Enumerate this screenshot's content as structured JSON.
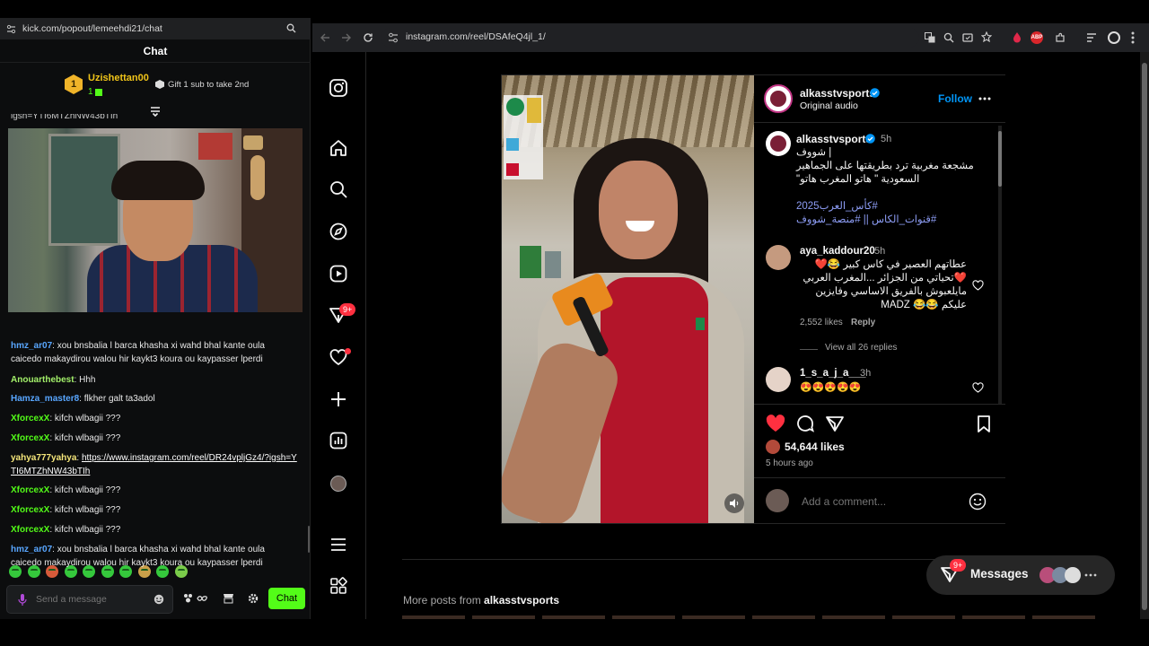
{
  "kick": {
    "url": "kick.com/popout/lemeehdi21/chat",
    "chat_title": "Chat",
    "gifter": {
      "rank": "1",
      "name": "Uzishettan00",
      "count": "1",
      "cta": "Gift 1 sub to take 2nd"
    },
    "top_partial": "igsh=YTI6MTZhNW43bTIh",
    "messages": [
      {
        "user": "hmz_ar07",
        "color": "blue",
        "text": ": xou bnsbalia l barca khasha xi wahd bhal kante oula caicedo makaydirou walou hir kaykt3 koura ou kaypasser lperdi"
      },
      {
        "user": "Anouarthebest",
        "color": "lime",
        "text": ": Hhh"
      },
      {
        "user": "Hamza_master8",
        "color": "blue",
        "text": ": flkher galt ta3adol"
      },
      {
        "user": "XforcexX",
        "color": "green",
        "text": ": kifch wlbagii ???"
      },
      {
        "user": "XforcexX",
        "color": "green",
        "text": ": kifch wlbagii ???"
      },
      {
        "user": "yahya777yahya",
        "color": "yellow",
        "text": ": ",
        "link": "https://www.instagram.com/reel/DR24vpljGz4/?igsh=YTI6MTZhNW43bTIh"
      },
      {
        "user": "XforcexX",
        "color": "green",
        "text": ": kifch wlbagii ???"
      },
      {
        "user": "XforcexX",
        "color": "green",
        "text": ": kifch wlbagii ???"
      },
      {
        "user": "XforcexX",
        "color": "green",
        "text": ": kifch wlbagii ???"
      },
      {
        "user": "hmz_ar07",
        "color": "blue",
        "text": ": xou bnsbalia l barca khasha xi wahd bhal kante oula caicedo makaydirou walou hir kaykt3 koura ou kaypasser lperdi"
      }
    ],
    "placeholder": "Send a message",
    "send_label": "Chat",
    "brand_green": "#53fc18"
  },
  "browser": {
    "url": "instagram.com/reel/DSAfeQ4jl_1/"
  },
  "instagram": {
    "nav_badge": "9+",
    "post": {
      "account": "alkasstvsports",
      "audio": "Original audio",
      "follow": "Follow",
      "caption_time": "5h",
      "caption_line1": "| شووف",
      "caption_line2": "مشجعة مغربية ترد بطريقتها على الجماهير",
      "caption_line3": "السعودية \" هاتو المغرب هاتو\"",
      "tags_line1": "#كأس_العرب2025",
      "tags_line2": "#قنوات_الكاس || #منصة_شووف",
      "comments": [
        {
          "user": "aya_kaddour20",
          "time": "5h",
          "line1": "عطاتهم العصير في كاس كبير 😂❤️",
          "line2": "❤️تحياتي من الجزائر ...المغرب العربي",
          "line3": "مايلعبوش بالفريق الاساسي وفايزين",
          "line4": "عليكم 😂😂 MADZ",
          "likes": "2,552 likes",
          "reply": "Reply",
          "view_replies": "View all 26 replies"
        },
        {
          "user": "1_s_a_j_a___",
          "time": "3h",
          "text": "😍😍😍😍😍"
        }
      ],
      "likes": "54,644 likes",
      "posted": "5 hours ago",
      "add_comment": "Add a comment..."
    },
    "more_posts_prefix": "More posts from ",
    "more_posts_account": "alkasstvsports",
    "messages_label": "Messages",
    "messages_badge": "9+"
  }
}
